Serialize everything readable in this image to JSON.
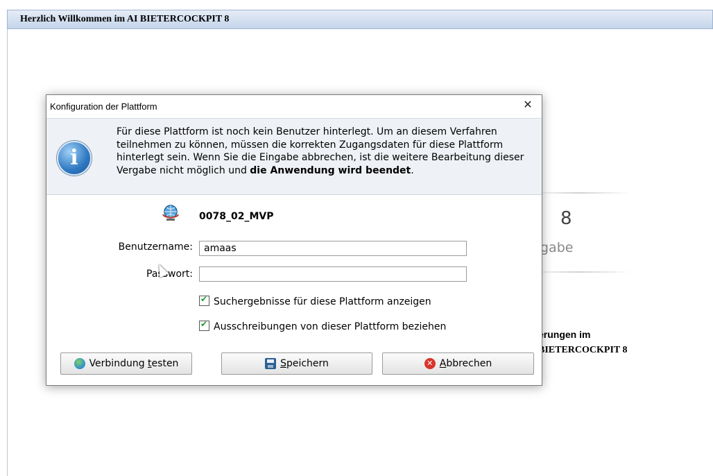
{
  "app": {
    "header_title": "Herzlich Willkommen im AI BIETERCOCKPIT 8",
    "background": {
      "big_number": "8",
      "partial_word": "gabe",
      "partial_line1": "erungen im",
      "partial_line2": "BIETERCOCKPIT 8"
    }
  },
  "dialog": {
    "title": "Konfiguration der Plattform",
    "close_label": "✕",
    "info_icon": "info-icon",
    "info_text_normal": "Für diese Plattform ist noch kein Benutzer hinterlegt. Um an diesem Verfahren teilnehmen zu können, müssen die korrekten Zugangsdaten für diese Plattform hinterlegt sein. Wenn Sie die Eingabe abbrechen, ist die weitere Bearbeitung dieser Vergabe nicht möglich und ",
    "info_text_bold": "die Anwendung wird beendet",
    "info_text_end": ".",
    "platform_name": "0078_02_MVP",
    "username_label": "Benutzername:",
    "username_value": "amaas",
    "password_label": "Passwort:",
    "password_value": "",
    "checkbox_search_label": "Suchergebnisse für diese Plattform anzeigen",
    "checkbox_search_checked": true,
    "checkbox_tenders_label": "Ausschreibungen von dieser Plattform beziehen",
    "checkbox_tenders_checked": true,
    "buttons": {
      "test_pre": "Verbindung ",
      "test_accel": "t",
      "test_post": "esten",
      "save_accel": "S",
      "save_post": "peichern",
      "cancel_accel": "A",
      "cancel_post": "bbrechen"
    }
  }
}
